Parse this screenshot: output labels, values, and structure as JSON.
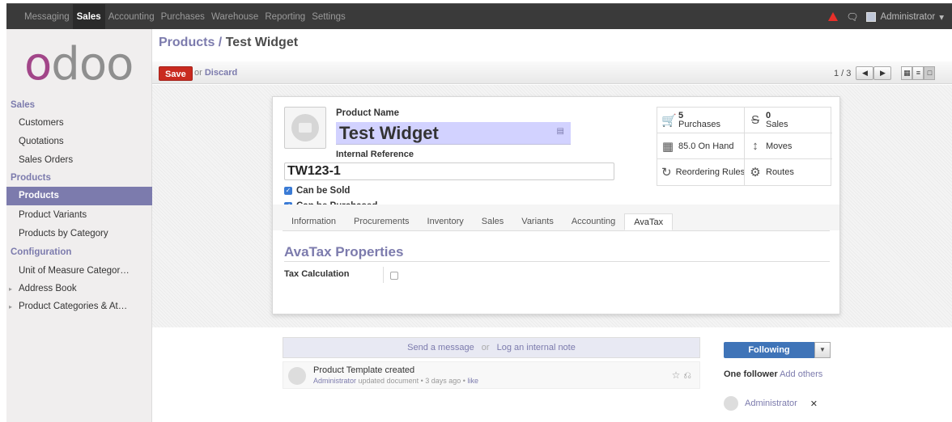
{
  "topbar": {
    "menu": [
      "Messaging",
      "Sales",
      "Accounting",
      "Purchases",
      "Warehouse",
      "Reporting",
      "Settings"
    ],
    "user": "Administrator",
    "user_caret": "▾"
  },
  "sidebar": {
    "sections": [
      {
        "title": "Sales",
        "items": [
          "Customers",
          "Quotations",
          "Sales Orders"
        ]
      },
      {
        "title": "Products",
        "items": [
          "Products",
          "Product Variants",
          "Products by Category"
        ]
      },
      {
        "title": "Configuration",
        "items": [
          "Unit of Measure Categor…",
          "Address Book",
          "Product Categories & At…"
        ]
      }
    ],
    "active_item": "Products",
    "logo_text": "odoo"
  },
  "breadcrumb": {
    "parent": "Products",
    "separator": "/",
    "current": "Test Widget"
  },
  "actions": {
    "save": "Save",
    "or": "or",
    "discard": "Discard"
  },
  "pager": {
    "text": "1 / 3"
  },
  "form": {
    "product_name_label": "Product Name",
    "product_name": "Test Widget",
    "internal_ref_label": "Internal Reference",
    "internal_ref": "TW123-1",
    "can_be_sold": "Can be Sold",
    "can_be_purchased": "Can be Purchased",
    "stats": {
      "purchases_count": "5",
      "purchases_label": "Purchases",
      "sales_count": "0",
      "sales_label": "Sales",
      "on_hand": "85.0 On Hand",
      "moves": "Moves",
      "reordering": "Reordering Rules",
      "routes": "Routes"
    },
    "tabs": [
      "Information",
      "Procurements",
      "Inventory",
      "Sales",
      "Variants",
      "Accounting",
      "AvaTax"
    ],
    "active_tab": "AvaTax",
    "avatax_title": "AvaTax Properties",
    "tax_calc_label": "Tax Calculation"
  },
  "chatter": {
    "send_message": "Send a message",
    "or": "or",
    "log_note": "Log an internal note",
    "message_title": "Product Template created",
    "message_author": "Administrator",
    "message_meta": "updated document • 3 days ago •",
    "message_like": "like",
    "following": "Following",
    "followers_count": "One follower",
    "add_others_1": "Add",
    "add_others_2": "others",
    "follower_name": "Administrator"
  },
  "colors": {
    "brand": "#7c7bad",
    "save": "#c92a1f",
    "following": "#3f74b8"
  }
}
